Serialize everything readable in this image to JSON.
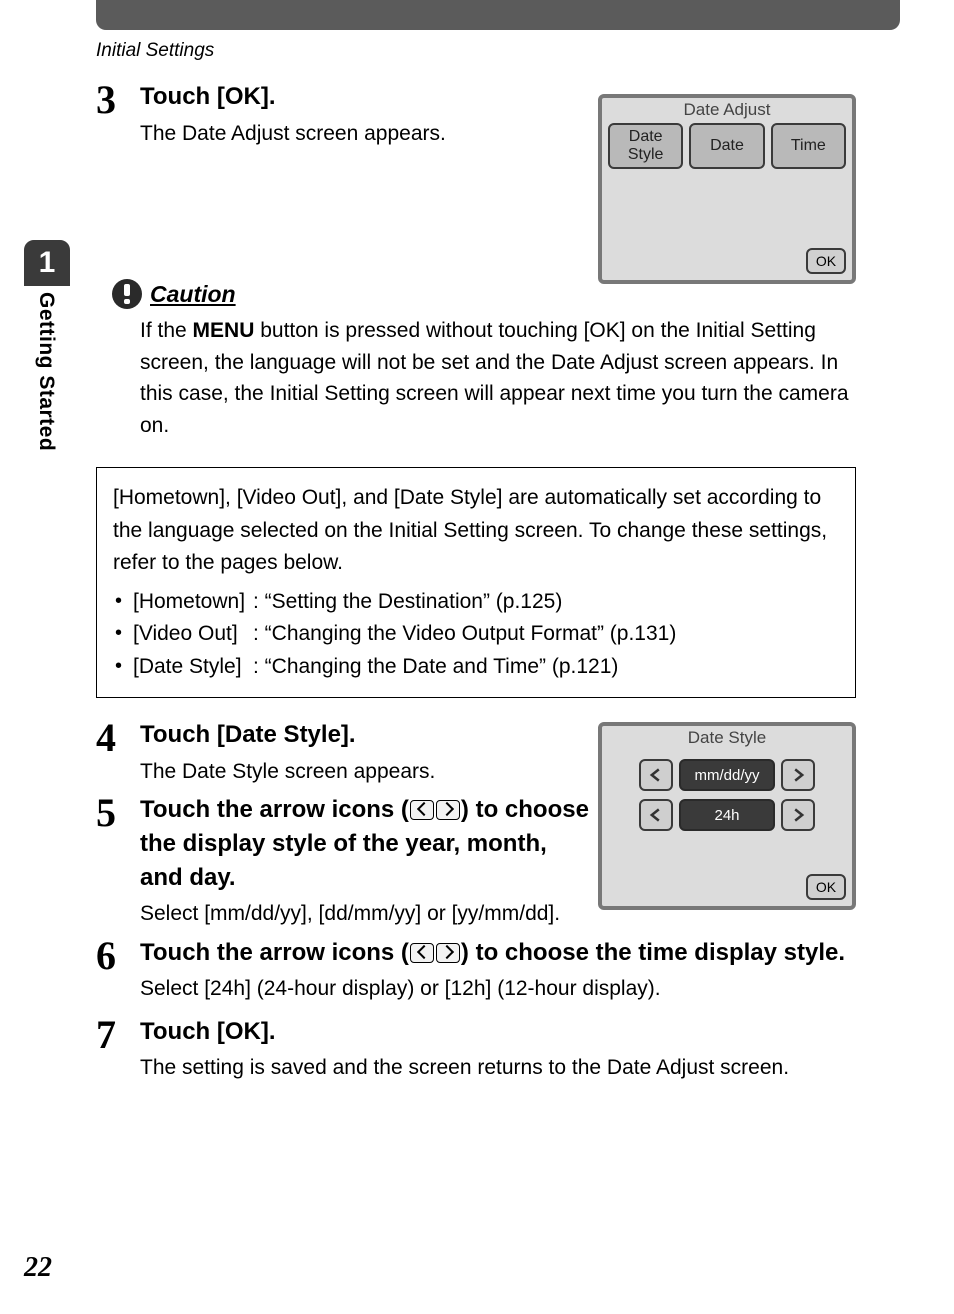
{
  "running_head": "Initial Settings",
  "sidetab": {
    "num": "1",
    "label": "Getting Started"
  },
  "step3": {
    "num": "3",
    "title": "Touch [OK].",
    "desc": "The Date Adjust screen appears."
  },
  "screen_da": {
    "title": "Date Adjust",
    "btn1": "Date\nStyle",
    "btn2": "Date",
    "btn3": "Time",
    "ok": "OK"
  },
  "caution": {
    "title": "Caution",
    "body_pre": "If the ",
    "body_menu": "MENU",
    "body_post": " button is pressed without touching [OK] on the Initial Setting screen, the language will not be set and the Date Adjust screen appears. In this case, the Initial Setting screen will appear next time you turn the camera on."
  },
  "info": {
    "intro": "[Hometown], [Video Out], and [Date Style] are automatically set according to the language selected on the Initial Setting screen. To change these settings, refer to the pages below.",
    "items": [
      {
        "label": "[Hometown]",
        "ref": ": “Setting the Destination” (p.125)"
      },
      {
        "label": "[Video Out]",
        "ref": ": “Changing the Video Output Format” (p.131)"
      },
      {
        "label": "[Date Style]",
        "ref": ": “Changing the Date and Time” (p.121)"
      }
    ]
  },
  "step4": {
    "num": "4",
    "title": "Touch [Date Style].",
    "desc": "The Date Style screen appears."
  },
  "step5": {
    "num": "5",
    "title_pre": "Touch the arrow icons (",
    "title_post": ") to choose the display style of the year, month, and day.",
    "desc": "Select [mm/dd/yy], [dd/mm/yy] or [yy/mm/dd]."
  },
  "step6": {
    "num": "6",
    "title_pre": "Touch the arrow icons (",
    "title_post": ") to choose the time display style.",
    "desc": "Select [24h] (24-hour display) or [12h] (12-hour display)."
  },
  "step7": {
    "num": "7",
    "title": "Touch [OK].",
    "desc": "The setting is saved and the screen returns to the Date Adjust screen."
  },
  "screen_ds": {
    "title": "Date Style",
    "val1": "mm/dd/yy",
    "val2": "24h",
    "ok": "OK"
  },
  "page_num": "22"
}
